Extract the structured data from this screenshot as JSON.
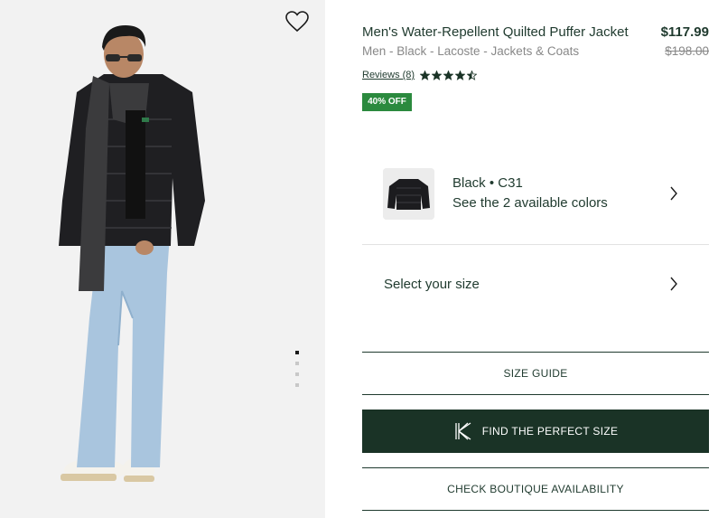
{
  "product": {
    "title": "Men's Water-Repellent Quilted Puffer Jacket",
    "price": "$117.99",
    "breadcrumb": "Men - Black - Lacoste - Jackets & Coats",
    "original_price": "$198.00",
    "reviews_label": "Reviews (8)",
    "rating": 4.5,
    "rating_max": 5,
    "discount_badge": "40% OFF"
  },
  "gallery": {
    "image": "product-photo-man-in-black-puffer-jacket",
    "wishlist_icon": "heart-outline-icon",
    "slides": 4,
    "active_slide": 1
  },
  "color_selector": {
    "name": "Black • C31",
    "subtitle": "See the 2 available colors",
    "icon": "chevron-right-icon"
  },
  "size_selector": {
    "label": "Select your size",
    "icon": "chevron-right-icon"
  },
  "buttons": {
    "size_guide": "SIZE GUIDE",
    "find_size": "FIND THE PERFECT SIZE",
    "find_size_icon": "kiwisizing-icon",
    "boutique": "CHECK BOUTIQUE AVAILABILITY"
  },
  "colors": {
    "brand_green": "#1a3326",
    "badge_green": "#2b8a3e",
    "text_muted": "#888888"
  }
}
